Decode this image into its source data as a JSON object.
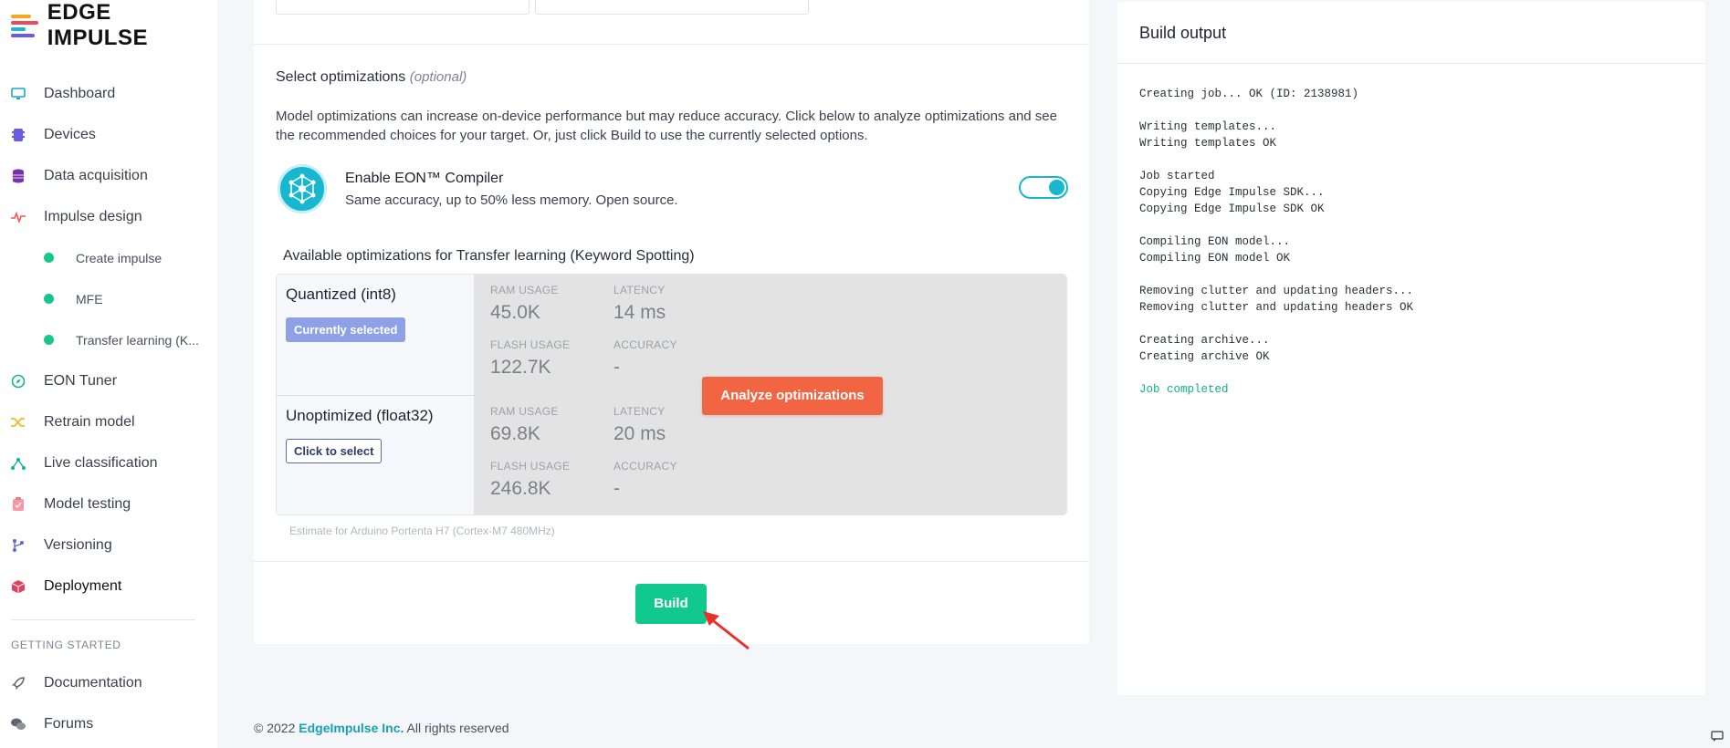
{
  "brand": {
    "name": "EDGE IMPULSE"
  },
  "sidebar": {
    "items": [
      {
        "label": "Dashboard",
        "icon": "monitor-icon",
        "color": "#20a6c7"
      },
      {
        "label": "Devices",
        "icon": "chip-icon",
        "color": "#6a5be2"
      },
      {
        "label": "Data acquisition",
        "icon": "database-icon",
        "color": "#7b2fa8"
      },
      {
        "label": "Impulse design",
        "icon": "pulse-icon",
        "color": "#f05a4f"
      },
      {
        "label": "Create impulse",
        "sub": true
      },
      {
        "label": "MFE",
        "sub": true
      },
      {
        "label": "Transfer learning (K...",
        "sub": true
      },
      {
        "label": "EON Tuner",
        "icon": "compass-icon",
        "color": "#16b780"
      },
      {
        "label": "Retrain model",
        "icon": "shuffle-icon",
        "color": "#f0b92a"
      },
      {
        "label": "Live classification",
        "icon": "graph-icon",
        "color": "#14b39a"
      },
      {
        "label": "Model testing",
        "icon": "clipboard-icon",
        "color": "#f59aa2"
      },
      {
        "label": "Versioning",
        "icon": "branch-icon",
        "color": "#6467c9"
      },
      {
        "label": "Deployment",
        "icon": "box-icon",
        "color": "#e0435e"
      }
    ],
    "section": "GETTING STARTED",
    "extra": [
      {
        "label": "Documentation",
        "icon": "rocket-icon"
      },
      {
        "label": "Forums",
        "icon": "chat-bubbles-icon"
      }
    ]
  },
  "main": {
    "optimizations": {
      "title": "Select optimizations",
      "optional": "(optional)",
      "description": "Model optimizations can increase on-device performance but may reduce accuracy. Click below to analyze optimizations and see the recommended choices for your target. Or, just click Build to use the currently selected options."
    },
    "eon": {
      "title": "Enable EON™ Compiler",
      "subtitle": "Same accuracy, up to 50% less memory. Open source.",
      "enabled": true
    },
    "available_title": "Available optimizations for Transfer learning (Keyword Spotting)",
    "rows": [
      {
        "name": "Quantized (int8)",
        "status": "Currently selected",
        "ram_label": "RAM USAGE",
        "ram": "45.0K",
        "latency_label": "LATENCY",
        "latency": "14 ms",
        "flash_label": "FLASH USAGE",
        "flash": "122.7K",
        "accuracy_label": "ACCURACY",
        "accuracy": "-"
      },
      {
        "name": "Unoptimized (float32)",
        "status": "Click to select",
        "ram_label": "RAM USAGE",
        "ram": "69.8K",
        "latency_label": "LATENCY",
        "latency": "20 ms",
        "flash_label": "FLASH USAGE",
        "flash": "246.8K",
        "accuracy_label": "ACCURACY",
        "accuracy": "-"
      }
    ],
    "analyze_label": "Analyze optimizations",
    "estimate": "Estimate for Arduino Portenta H7 (Cortex-M7 480MHz)",
    "build_label": "Build"
  },
  "footer": {
    "copyright": "© 2022",
    "company": "EdgeImpulse Inc.",
    "rights": "All rights reserved"
  },
  "build_output": {
    "title": "Build output",
    "lines": [
      "Creating job... OK (ID: 2138981)",
      "",
      "Writing templates...",
      "Writing templates OK",
      "",
      "Job started",
      "Copying Edge Impulse SDK...",
      "Copying Edge Impulse SDK OK",
      "",
      "Compiling EON model...",
      "Compiling EON model OK",
      "",
      "Removing clutter and updating headers...",
      "Removing clutter and updating headers OK",
      "",
      "Creating archive...",
      "Creating archive OK",
      ""
    ],
    "completed": "Job completed"
  }
}
